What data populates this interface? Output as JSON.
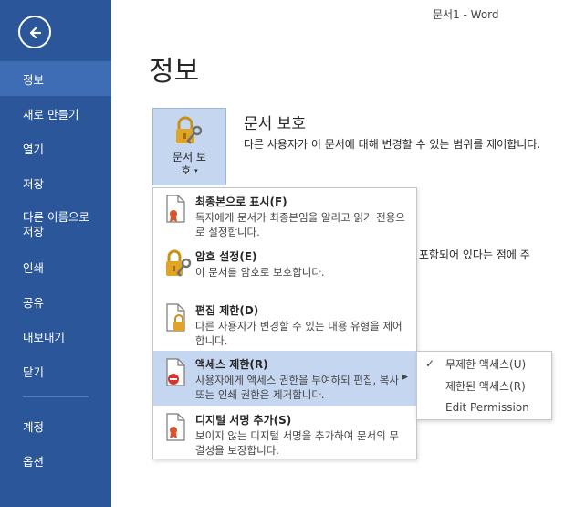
{
  "window": {
    "title": "문서1 - Word"
  },
  "sidebar": {
    "items": [
      {
        "label": "정보"
      },
      {
        "label": "새로 만들기"
      },
      {
        "label": "열기"
      },
      {
        "label": "저장"
      },
      {
        "label": "다른 이름으로\n저장"
      },
      {
        "label": "인쇄"
      },
      {
        "label": "공유"
      },
      {
        "label": "내보내기"
      },
      {
        "label": "닫기"
      },
      {
        "label": "계정"
      },
      {
        "label": "옵션"
      }
    ]
  },
  "main": {
    "title": "정보",
    "protect": {
      "button_label": "문서 보\n호",
      "caret": "▾",
      "heading": "문서 보호",
      "description": "다른 사용자가 이 문서에 대해 변경할 수 있는 범위를 제어합니다."
    },
    "background_text": "용이 포함되어 있다는 점에 주"
  },
  "menu": {
    "items": [
      {
        "title": "최종본으로 표시(F)",
        "desc": "독자에게 문서가 최종본임을 알리고 읽기 전용으로 설정합니다.",
        "icon": "doc-ribbon-icon"
      },
      {
        "title": "암호 설정(E)",
        "desc": "이 문서를 암호로 보호합니다.",
        "icon": "lock-key-icon"
      },
      {
        "title": "편집 제한(D)",
        "desc": "다른 사용자가 변경할 수 있는 내용 유형을 제어합니다.",
        "icon": "doc-lock-icon"
      },
      {
        "title": "액세스 제한(R)",
        "desc": "사용자에게 액세스 권한을 부여하되 편집, 복사 또는 인쇄 권한은 제거합니다.",
        "icon": "doc-restrict-icon",
        "arrow": "▶"
      },
      {
        "title": "디지털 서명 추가(S)",
        "desc": "보이지 않는 디지털 서명을 추가하여 문서의 무결성을 보장합니다.",
        "icon": "doc-signature-icon"
      }
    ]
  },
  "submenu": {
    "check": "✓",
    "items": [
      {
        "label": "무제한 액세스(U)"
      },
      {
        "label": "제한된 액세스(R)"
      },
      {
        "label": "Edit Permission"
      }
    ]
  },
  "colors": {
    "sidebar": "#2b579a",
    "sidebar_active": "#3e6db5",
    "highlight": "#c5d6f0",
    "lock_gold": "#e0a526"
  }
}
